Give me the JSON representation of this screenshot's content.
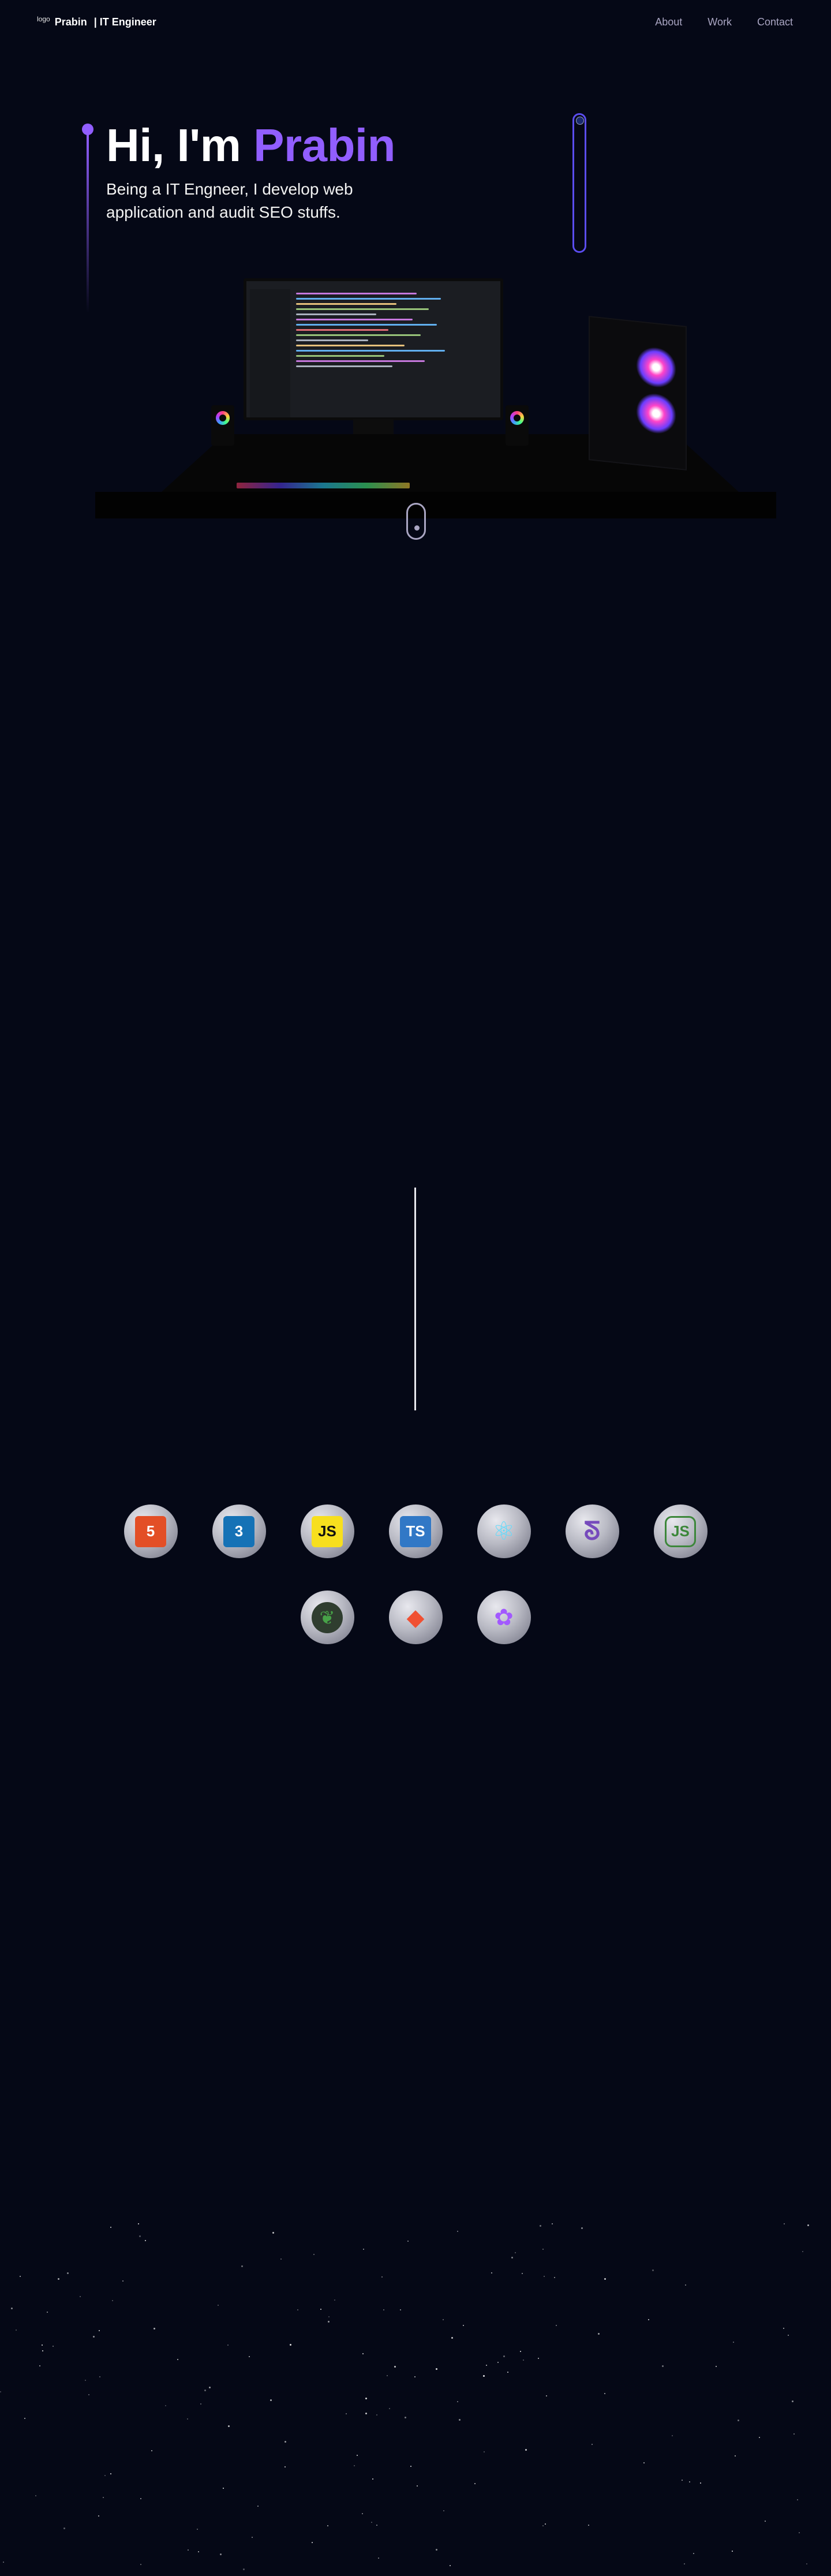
{
  "nav": {
    "logo_alt": "logo",
    "name": "Prabin",
    "subtitle": "| IT Engineer",
    "links": [
      "About",
      "Work",
      "Contact"
    ]
  },
  "hero": {
    "greeting": "Hi, I'm",
    "name": "Prabin",
    "description": "Being a IT Engneer, I develop web application and audit SEO stuffs."
  },
  "colors": {
    "background": "#050816",
    "accent": "#915eff",
    "nav_link": "#aaa6c3"
  },
  "technologies": [
    {
      "name": "HTML 5",
      "icon": "html5-icon",
      "label": "5",
      "color": "#e34f26"
    },
    {
      "name": "CSS 3",
      "icon": "css3-icon",
      "label": "3",
      "color": "#1572b6"
    },
    {
      "name": "JavaScript",
      "icon": "javascript-icon",
      "label": "JS",
      "color": "#f7df1e"
    },
    {
      "name": "TypeScript",
      "icon": "typescript-icon",
      "label": "TS",
      "color": "#3178c6"
    },
    {
      "name": "React JS",
      "icon": "react-icon",
      "label": "⚛",
      "color": "#61dafb"
    },
    {
      "name": "Redux Toolkit",
      "icon": "redux-icon",
      "label": "ᘕ",
      "color": "#764abc"
    },
    {
      "name": "Node JS",
      "icon": "nodejs-icon",
      "label": "JS",
      "color": "#3c873a"
    },
    {
      "name": "MongoDB",
      "icon": "mongodb-icon",
      "label": "❦",
      "color": "#47a248"
    },
    {
      "name": "git",
      "icon": "git-icon",
      "label": "◆",
      "color": "#f05032"
    },
    {
      "name": "figma",
      "icon": "figma-icon",
      "label": "✿",
      "color": "#a259ff"
    }
  ]
}
